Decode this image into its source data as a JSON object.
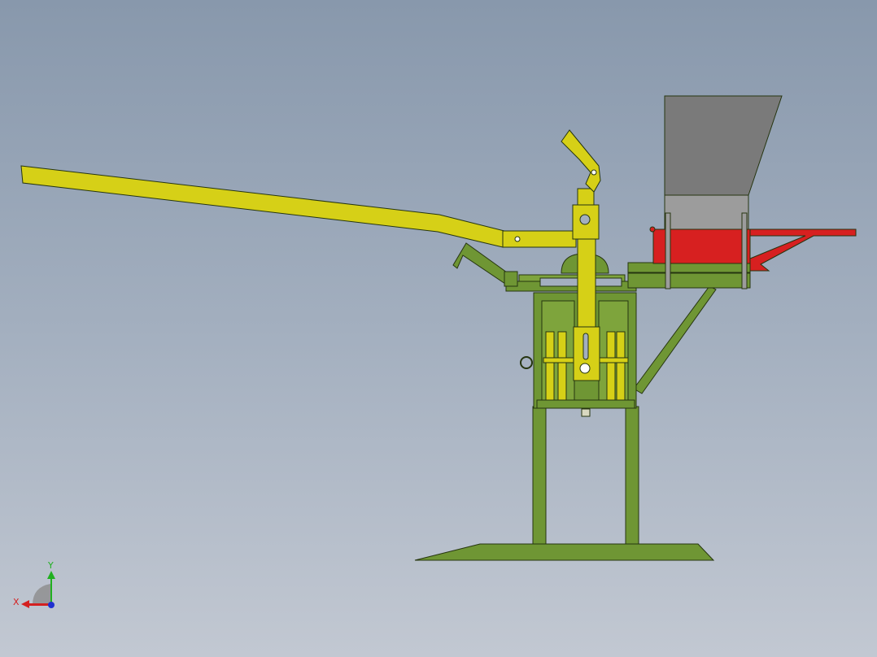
{
  "triad": {
    "x_label": "X",
    "y_label": "Y",
    "x_color": "#d42020",
    "y_color": "#20b020",
    "z_color": "#2030d0"
  },
  "colors": {
    "frame_green": "#6f9634",
    "yellow": "#d6d017",
    "hopper_gray": "#7a7a7a",
    "hopper_light": "#9c9c9c",
    "hopper_red": "#d72020",
    "outline": "#2a3a10"
  }
}
